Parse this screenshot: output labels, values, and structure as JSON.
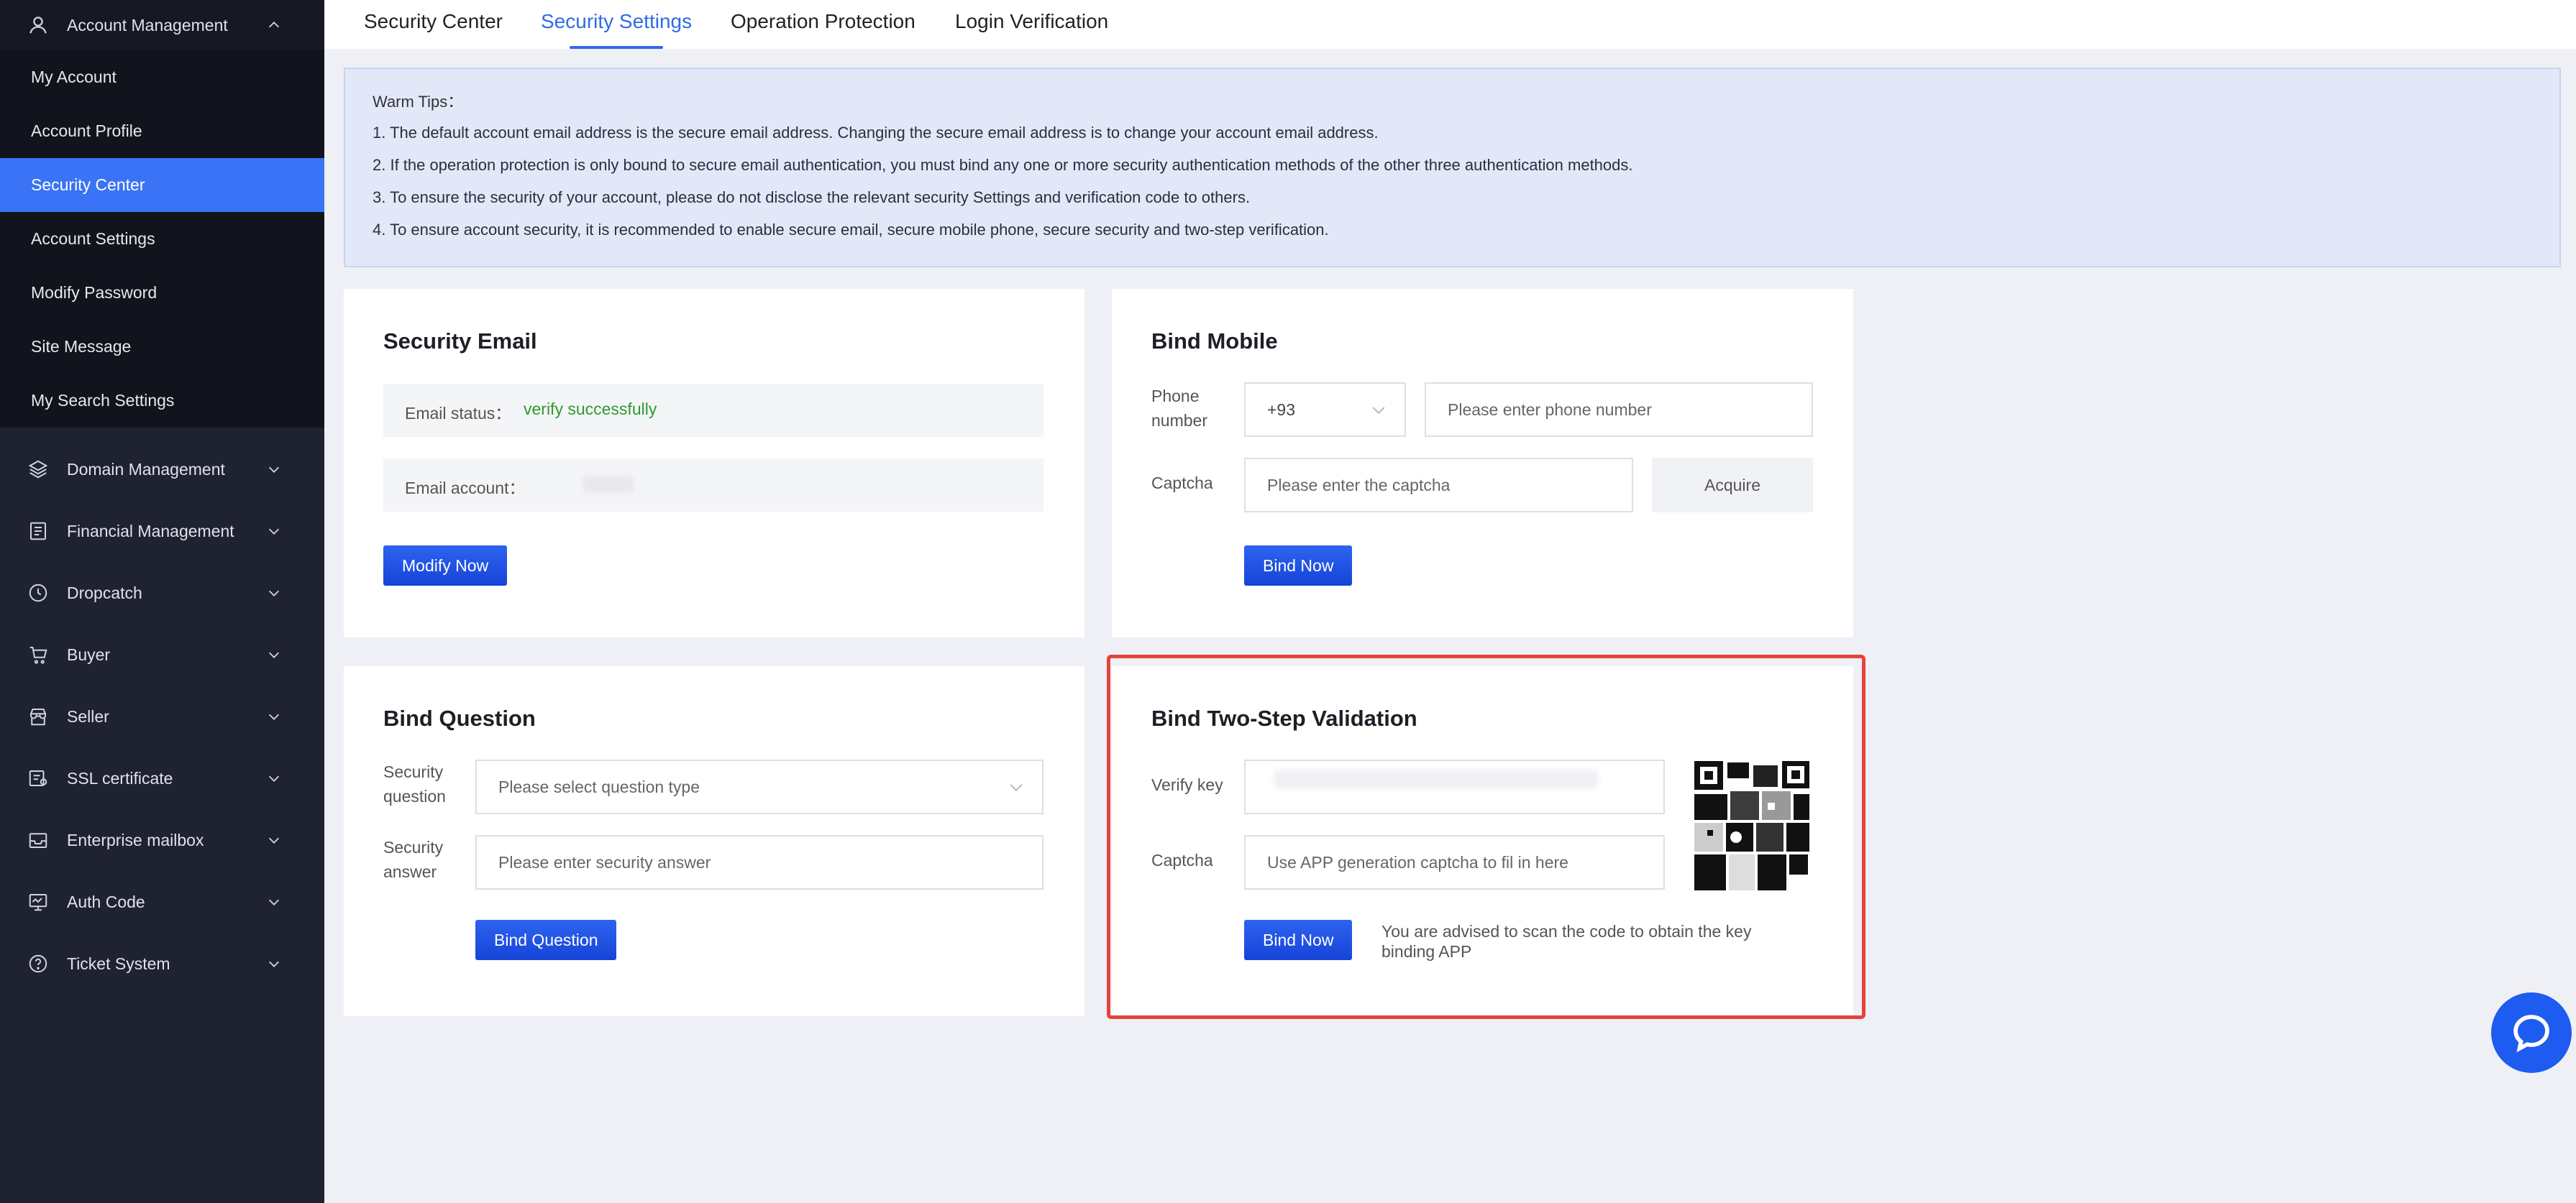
{
  "sidebar": {
    "header": {
      "label": "Account Management",
      "icon": "user-icon"
    },
    "sub_items": [
      {
        "label": "My Account"
      },
      {
        "label": "Account Profile"
      },
      {
        "label": "Security Center",
        "active": true
      },
      {
        "label": "Account Settings"
      },
      {
        "label": "Modify Password"
      },
      {
        "label": "Site Message"
      },
      {
        "label": "My Search Settings"
      }
    ],
    "groups": [
      {
        "label": "Domain Management",
        "icon": "layers-icon"
      },
      {
        "label": "Financial Management",
        "icon": "ledger-icon"
      },
      {
        "label": "Dropcatch",
        "icon": "clock-icon"
      },
      {
        "label": "Buyer",
        "icon": "cart-icon"
      },
      {
        "label": "Seller",
        "icon": "store-icon"
      },
      {
        "label": "SSL certificate",
        "icon": "certificate-icon"
      },
      {
        "label": "Enterprise mailbox",
        "icon": "mailbox-icon"
      },
      {
        "label": "Auth Code",
        "icon": "monitor-icon"
      },
      {
        "label": "Ticket System",
        "icon": "help-icon"
      }
    ]
  },
  "tabs": [
    {
      "label": "Security Center"
    },
    {
      "label": "Security Settings",
      "active": true
    },
    {
      "label": "Operation Protection"
    },
    {
      "label": "Login Verification"
    }
  ],
  "tips": {
    "title": "Warm Tips：",
    "lines": [
      "1. The default account email address is the secure email address. Changing the secure email address is to change your account email address.",
      "2. If the operation protection is only bound to secure email authentication, you must bind any one or more security authentication methods of the other three authentication methods.",
      "3. To ensure the security of your account, please do not disclose the relevant security Settings and verification code to others.",
      "4. To ensure account security, it is recommended to enable secure email, secure mobile phone, secure security and two-step verification."
    ]
  },
  "security_email": {
    "title": "Security Email",
    "status_label": "Email status：",
    "status_value": "verify successfully",
    "account_label": "Email account：",
    "button": "Modify Now"
  },
  "bind_mobile": {
    "title": "Bind Mobile",
    "phone_label_1": "Phone",
    "phone_label_2": "number",
    "country_code": "+93",
    "phone_placeholder": "Please enter phone number",
    "captcha_label": "Captcha",
    "captcha_placeholder": "Please enter the captcha",
    "acquire": "Acquire",
    "button": "Bind Now"
  },
  "bind_question": {
    "title": "Bind Question",
    "q_label_1": "Security",
    "q_label_2": "question",
    "q_placeholder": "Please select question type",
    "a_label_1": "Security",
    "a_label_2": "answer",
    "a_placeholder": "Please enter security answer",
    "button": "Bind Question"
  },
  "two_step": {
    "title": "Bind Two-Step Validation",
    "key_label": "Verify key",
    "captcha_label": "Captcha",
    "captcha_placeholder": "Use APP generation captcha to fil in here",
    "button": "Bind Now",
    "hint_1": "You are advised to scan the code to obtain the key",
    "hint_2": "binding APP"
  },
  "colors": {
    "accent": "#2f6be6",
    "success": "#2e9a2e",
    "highlight": "#e5433a",
    "sidebar_bg": "#1f2230"
  }
}
